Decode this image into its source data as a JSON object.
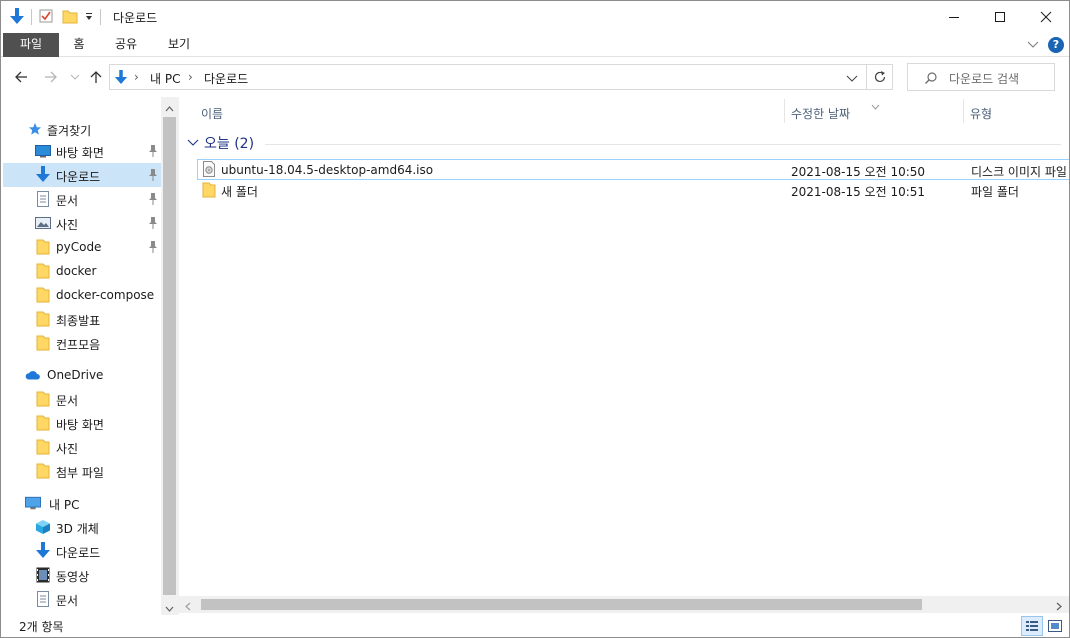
{
  "window": {
    "title": "다운로드",
    "minimize_label": "Minimize",
    "maximize_label": "Maximize",
    "close_label": "Close"
  },
  "ribbon": {
    "tabs": [
      {
        "label": "파일",
        "active": true
      },
      {
        "label": "홈",
        "active": false
      },
      {
        "label": "공유",
        "active": false
      },
      {
        "label": "보기",
        "active": false
      }
    ],
    "help_label": "?"
  },
  "address": {
    "path": [
      "내 PC",
      "다운로드"
    ],
    "separator": "›"
  },
  "search": {
    "placeholder": "다운로드 검색"
  },
  "navigation": {
    "quick_access": {
      "label": "즐겨찾기"
    },
    "quick_items": [
      {
        "label": "바탕 화면",
        "icon": "desktop-icon",
        "pinned": true
      },
      {
        "label": "다운로드",
        "icon": "download-arrow-icon",
        "pinned": true,
        "selected": true
      },
      {
        "label": "문서",
        "icon": "document-icon",
        "pinned": true
      },
      {
        "label": "사진",
        "icon": "picture-icon",
        "pinned": true
      },
      {
        "label": "pyCode",
        "icon": "folder-icon",
        "pinned": true
      },
      {
        "label": "docker",
        "icon": "folder-icon",
        "pinned": false
      },
      {
        "label": "docker-compose",
        "icon": "folder-icon",
        "pinned": false
      },
      {
        "label": "최종발표",
        "icon": "folder-icon",
        "pinned": false
      },
      {
        "label": "컨프모음",
        "icon": "folder-icon",
        "pinned": false
      }
    ],
    "onedrive": {
      "label": "OneDrive"
    },
    "onedrive_items": [
      {
        "label": "문서"
      },
      {
        "label": "바탕 화면"
      },
      {
        "label": "사진"
      },
      {
        "label": "첨부 파일"
      }
    ],
    "this_pc": {
      "label": "내 PC"
    },
    "pc_items": [
      {
        "label": "3D 개체",
        "icon": "cube-3d-icon"
      },
      {
        "label": "다운로드",
        "icon": "download-arrow-icon"
      },
      {
        "label": "동영상",
        "icon": "video-icon"
      },
      {
        "label": "문서",
        "icon": "document-icon"
      }
    ]
  },
  "file_list": {
    "columns": {
      "name": "이름",
      "modified": "수정한 날짜",
      "type": "유형"
    },
    "group": {
      "label": "오늘 (2)"
    },
    "files": [
      {
        "name": "ubuntu-18.04.5-desktop-amd64.iso",
        "modified": "2021-08-15 오전 10:50",
        "type": "디스크 이미지 파일",
        "icon": "disc-image-icon"
      },
      {
        "name": "새 폴더",
        "modified": "2021-08-15 오전 10:51",
        "type": "파일 폴더",
        "icon": "folder-icon"
      }
    ]
  },
  "status": {
    "item_count": "2개 항목"
  },
  "colors": {
    "accent_blue": "#1e78d7",
    "folder_yellow": "#ffd764",
    "selection": "#cce4f7",
    "group_header": "#1e3287"
  }
}
